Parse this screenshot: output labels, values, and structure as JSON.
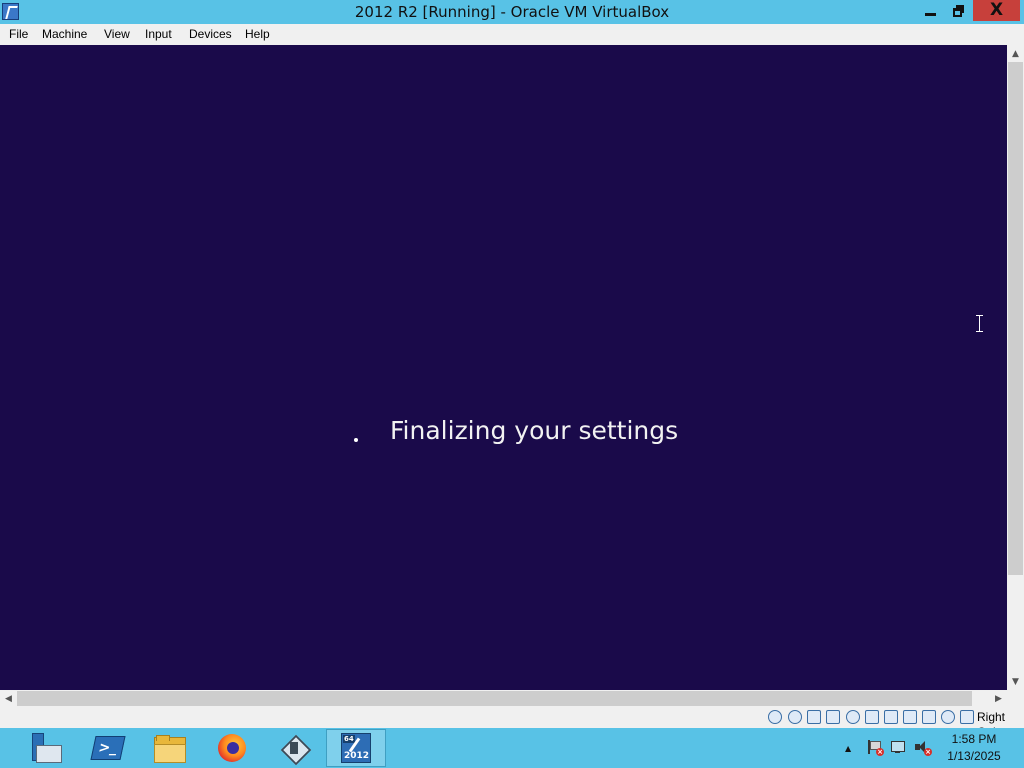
{
  "window": {
    "title": "2012 R2 [Running] - Oracle VM VirtualBox",
    "minimize_icon": "minimize-icon",
    "maximize_icon": "restore-icon",
    "close_icon": "close-icon",
    "close_glyph": "X",
    "titlebar_color": "#58c2e6",
    "close_color": "#c7403b"
  },
  "menu": {
    "items": [
      {
        "label": "File"
      },
      {
        "label": "Machine"
      },
      {
        "label": "View"
      },
      {
        "label": "Input"
      },
      {
        "label": "Devices"
      },
      {
        "label": "Help"
      }
    ]
  },
  "guest_screen": {
    "background": "#1a0a4a",
    "status_text": "Finalizing your settings",
    "spinner_icon": "loading-spinner-icon",
    "cursor_icon": "text-cursor-icon"
  },
  "statusbar": {
    "icons": [
      "hard-disk-icon",
      "optical-drive-icon",
      "audio-icon",
      "network-icon",
      "usb-icon",
      "shared-folders-icon",
      "display-icon",
      "video-capture-icon",
      "cpu-virtualization-icon",
      "mouse-integration-icon",
      "keyboard-icon"
    ],
    "host_key": "Right Ctrl"
  },
  "taskbar": {
    "background": "#58c2e6",
    "buttons": [
      {
        "name": "server-manager",
        "icon": "server-manager-icon"
      },
      {
        "name": "powershell",
        "icon": "powershell-icon",
        "glyph": ">_"
      },
      {
        "name": "file-explorer",
        "icon": "folder-icon"
      },
      {
        "name": "firefox",
        "icon": "firefox-icon"
      },
      {
        "name": "virtualbox",
        "icon": "virtualbox-icon"
      },
      {
        "name": "vm-2012-r2",
        "icon": "vm-2012-icon",
        "badge": "64",
        "label": "2012"
      }
    ],
    "tray": {
      "overflow_icon": "show-hidden-icons-icon",
      "overflow_glyph": "▲",
      "icons": [
        "action-center-icon",
        "network-status-icon",
        "volume-muted-icon"
      ],
      "time": "1:58 PM",
      "date": "1/13/2025"
    }
  }
}
